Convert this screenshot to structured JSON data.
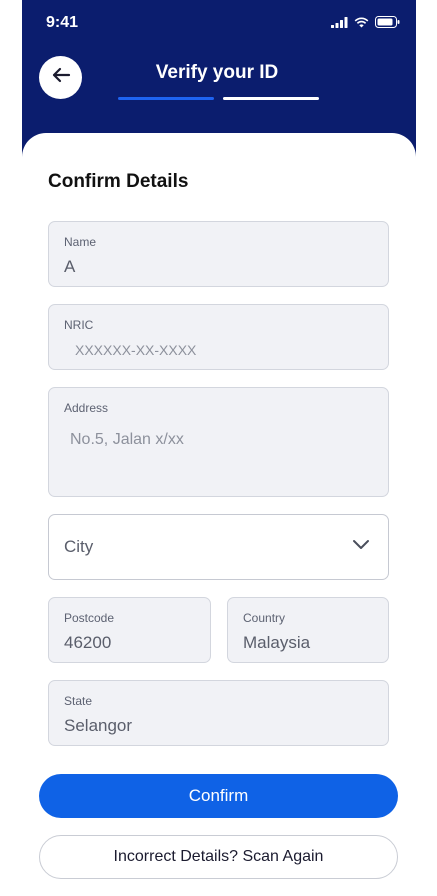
{
  "status_bar": {
    "time": "9:41"
  },
  "header": {
    "title": "Verify your ID",
    "progress": {
      "total_steps": 2,
      "current_step": 1
    }
  },
  "form": {
    "section_title": "Confirm Details",
    "name": {
      "label": "Name",
      "value": "A"
    },
    "nric": {
      "label": "NRIC",
      "placeholder": "XXXXXX-XX-XXXX"
    },
    "address": {
      "label": "Address",
      "placeholder": "No.5, Jalan x/xx"
    },
    "city": {
      "selected": "City"
    },
    "postcode": {
      "label": "Postcode",
      "value": "46200"
    },
    "country": {
      "label": "Country",
      "value": "Malaysia"
    },
    "state": {
      "label": "State",
      "value": "Selangor"
    }
  },
  "actions": {
    "confirm_label": "Confirm",
    "scan_again_label": "Incorrect Details? Scan Again"
  },
  "icons": {
    "back": "arrow-left-icon",
    "signal": "signal-icon",
    "wifi": "wifi-icon",
    "battery": "battery-icon",
    "dropdown": "chevron-down-icon"
  },
  "colors": {
    "header_bg": "#0b1d6e",
    "accent": "#0f62e6",
    "field_bg": "#f1f2f6"
  }
}
